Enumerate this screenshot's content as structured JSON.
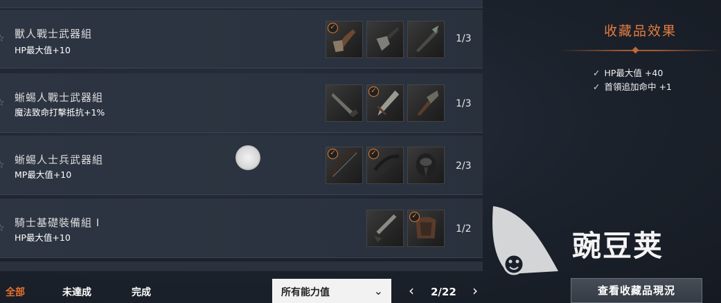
{
  "collections": [
    {
      "name": "獸人戰士武器組",
      "effect": "HP最大值+10",
      "count": "1/3",
      "slots": [
        {
          "icon": "axe-icon",
          "collected": true
        },
        {
          "icon": "dagger-icon",
          "collected": false
        },
        {
          "icon": "spear-icon",
          "collected": false
        }
      ]
    },
    {
      "name": "蜥蜴人戰士武器組",
      "effect": "魔法致命打擊抵抗+1%",
      "count": "1/3",
      "slots": [
        {
          "icon": "sword-icon",
          "collected": false
        },
        {
          "icon": "blade-icon",
          "collected": true
        },
        {
          "icon": "club-icon",
          "collected": false
        }
      ]
    },
    {
      "name": "蜥蜴人士兵武器組",
      "effect": "MP最大值+10",
      "count": "2/3",
      "slots": [
        {
          "icon": "bow-icon",
          "collected": true
        },
        {
          "icon": "crossbow-icon",
          "collected": true
        },
        {
          "icon": "helmet-icon",
          "collected": false
        }
      ]
    },
    {
      "name": "騎士基礎裝備組 Ⅰ",
      "effect": "HP最大值+10",
      "count": "1/2",
      "slots": [
        {
          "icon": "sword-icon",
          "collected": false
        },
        {
          "icon": "armor-icon",
          "collected": true
        }
      ]
    }
  ],
  "panel": {
    "title": "收藏品效果",
    "effects": [
      "HP最大值 +40",
      "首領追加命中 +1"
    ],
    "tick": "✓"
  },
  "filters": {
    "all": "全部",
    "incomplete": "未達成",
    "complete": "完成"
  },
  "dropdown": {
    "selected": "所有能力值",
    "chevron": "⌄"
  },
  "pager": {
    "text": "2/22",
    "prev": "‹",
    "next": "›"
  },
  "view_button": "查看收藏品現況",
  "watermark": "豌豆荚",
  "colors": {
    "accent": "#e8702f",
    "check": "#e0803a",
    "panel_title": "#e57b3f"
  }
}
